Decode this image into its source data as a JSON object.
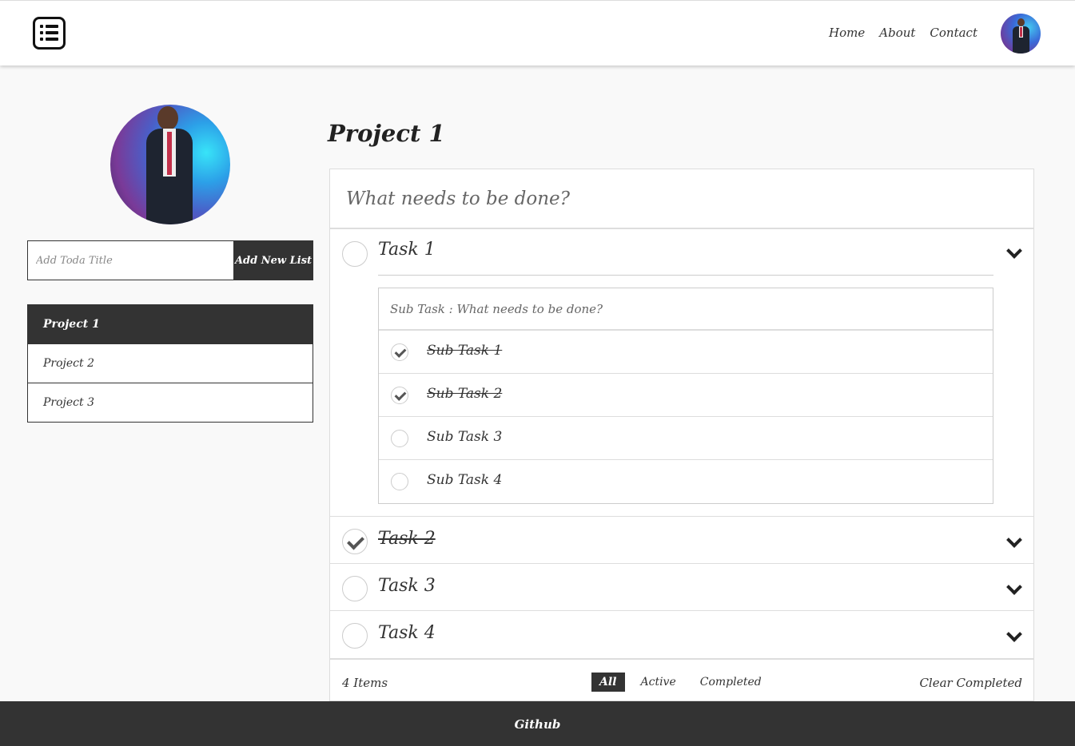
{
  "nav": {
    "items": [
      "Home",
      "About",
      "Contact"
    ]
  },
  "sidebar": {
    "add_input_placeholder": "Add Toda Title",
    "add_button": "Add New List",
    "projects": [
      {
        "label": "Project 1",
        "active": true
      },
      {
        "label": "Project 2",
        "active": false
      },
      {
        "label": "Project 3",
        "active": false
      }
    ]
  },
  "main": {
    "title": "Project 1",
    "new_todo_placeholder": "What needs to be done?",
    "tasks": [
      {
        "label": "Task 1",
        "completed": false,
        "expanded": true
      },
      {
        "label": "Task 2",
        "completed": true,
        "expanded": false
      },
      {
        "label": "Task 3",
        "completed": false,
        "expanded": false
      },
      {
        "label": "Task 4",
        "completed": false,
        "expanded": false
      }
    ],
    "subtask_placeholder": "Sub Task : What needs to be done?",
    "subtasks": [
      {
        "label": "Sub Task 1",
        "completed": true
      },
      {
        "label": "Sub Task 2",
        "completed": true
      },
      {
        "label": "Sub Task 3",
        "completed": false
      },
      {
        "label": "Sub Task 4",
        "completed": false
      }
    ],
    "footer": {
      "count": "4 Items",
      "filters": [
        "All",
        "Active",
        "Completed"
      ],
      "selected_filter": "All",
      "clear": "Clear Completed"
    }
  },
  "site_footer": {
    "link": "Github"
  },
  "colors": {
    "dark": "#333333",
    "background": "#f9f9f9",
    "border": "#dddddd"
  }
}
